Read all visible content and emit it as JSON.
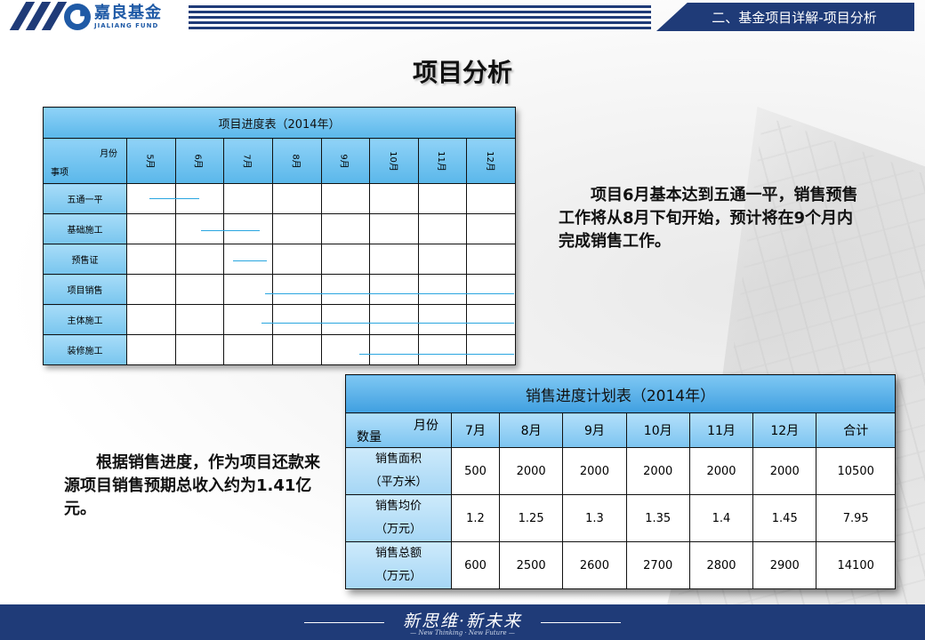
{
  "header": {
    "logo_cn": "嘉良基金",
    "logo_en": "JIALIANG FUND",
    "section": "二、基金项目详解-项目分析"
  },
  "page_title": "项目分析",
  "progress_table": {
    "caption": "项目进度表（2014年）",
    "corner_top": "月份",
    "corner_bottom": "事项",
    "months": [
      "5月",
      "6月",
      "7月",
      "8月",
      "9月",
      "10月",
      "11月",
      "12月"
    ],
    "rows": [
      "五通一平",
      "基础施工",
      "预售证",
      "项目销售",
      "主体施工",
      "装修施工"
    ],
    "bar_color": "#2aa6e0"
  },
  "paragraph_right": "项目6月基本达到五通一平，销售预售工作将从8月下旬开始，预计将在9个月内完成销售工作。",
  "paragraph_left": "根据销售进度，作为项目还款来源项目销售预期总收入约为1.41亿元。",
  "sales_table": {
    "caption": "销售进度计划表（2014年）",
    "corner_top": "月份",
    "corner_bottom": "数量",
    "columns": [
      "7月",
      "8月",
      "9月",
      "10月",
      "11月",
      "12月",
      "合计"
    ],
    "rows": [
      {
        "label1": "销售面积",
        "label2": "（平方米）",
        "values": [
          "500",
          "2000",
          "2000",
          "2000",
          "2000",
          "2000",
          "10500"
        ]
      },
      {
        "label1": "销售均价",
        "label2": "（万元）",
        "values": [
          "1.2",
          "1.25",
          "1.3",
          "1.35",
          "1.4",
          "1.45",
          "7.95"
        ]
      },
      {
        "label1": "销售总额",
        "label2": "（万元）",
        "values": [
          "600",
          "2500",
          "2600",
          "2700",
          "2800",
          "2900",
          "14100"
        ]
      }
    ]
  },
  "footer": {
    "slogan": "新思维·新未来",
    "slogan_en": "— New Thinking · New Future —"
  },
  "colors": {
    "brand": "#1f3b78",
    "table_header": "#5ab7ea"
  }
}
